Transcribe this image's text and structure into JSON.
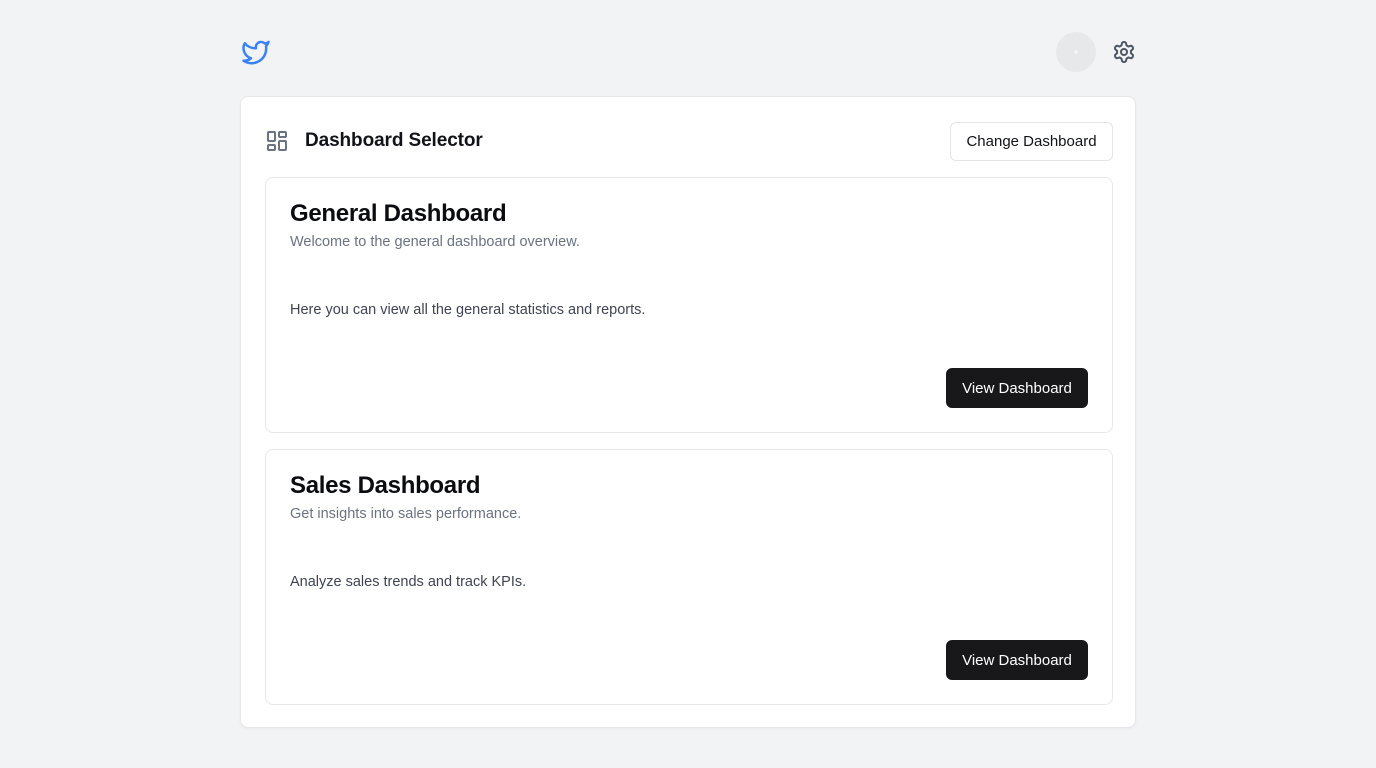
{
  "header": {
    "logo_icon": "twitter-bird-icon",
    "avatar_icon": "avatar",
    "settings_icon": "gear-icon"
  },
  "panel": {
    "icon": "layout-grid-icon",
    "title": "Dashboard Selector",
    "change_button_label": "Change Dashboard"
  },
  "cards": [
    {
      "title": "General Dashboard",
      "subtitle": "Welcome to the general dashboard overview.",
      "body": "Here you can view all the general statistics and reports.",
      "button_label": "View Dashboard"
    },
    {
      "title": "Sales Dashboard",
      "subtitle": "Get insights into sales performance.",
      "body": "Analyze sales trends and track KPIs.",
      "button_label": "View Dashboard"
    }
  ],
  "colors": {
    "background": "#f2f3f5",
    "accent": "#3b82f6",
    "primary_button": "#18181b"
  }
}
